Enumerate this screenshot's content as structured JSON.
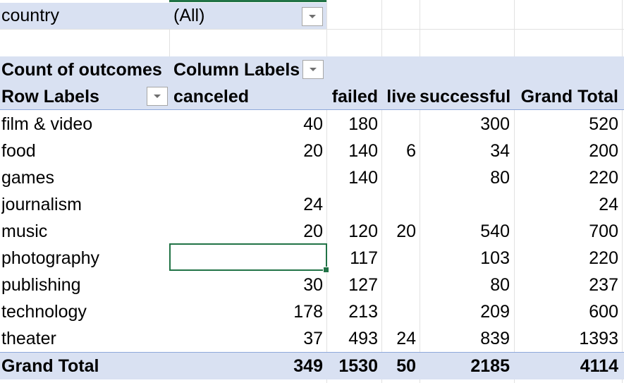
{
  "filter": {
    "label": "country",
    "value": "(All)"
  },
  "pivot": {
    "value_field": "Count of outcomes",
    "column_labels": "Column Labels",
    "row_labels": "Row Labels",
    "columns": [
      "canceled",
      "failed",
      "live",
      "successful",
      "Grand Total"
    ],
    "rows": [
      {
        "label": "film & video",
        "canceled": "40",
        "failed": "180",
        "live": "",
        "successful": "300",
        "total": "520"
      },
      {
        "label": "food",
        "canceled": "20",
        "failed": "140",
        "live": "6",
        "successful": "34",
        "total": "200"
      },
      {
        "label": "games",
        "canceled": "",
        "failed": "140",
        "live": "",
        "successful": "80",
        "total": "220"
      },
      {
        "label": "journalism",
        "canceled": "24",
        "failed": "",
        "live": "",
        "successful": "",
        "total": "24"
      },
      {
        "label": "music",
        "canceled": "20",
        "failed": "120",
        "live": "20",
        "successful": "540",
        "total": "700"
      },
      {
        "label": "photography",
        "canceled": "",
        "failed": "117",
        "live": "",
        "successful": "103",
        "total": "220"
      },
      {
        "label": "publishing",
        "canceled": "30",
        "failed": "127",
        "live": "",
        "successful": "80",
        "total": "237"
      },
      {
        "label": "technology",
        "canceled": "178",
        "failed": "213",
        "live": "",
        "successful": "209",
        "total": "600"
      },
      {
        "label": "theater",
        "canceled": "37",
        "failed": "493",
        "live": "24",
        "successful": "839",
        "total": "1393"
      }
    ],
    "grand_total": {
      "label": "Grand Total",
      "canceled": "349",
      "failed": "1530",
      "live": "50",
      "successful": "2185",
      "total": "4114"
    }
  },
  "colors": {
    "header_band": "#d9e1f2",
    "selection": "#217346",
    "gridline": "#e1e1e1"
  },
  "icons": {
    "dropdown": "chevron-down-icon"
  }
}
